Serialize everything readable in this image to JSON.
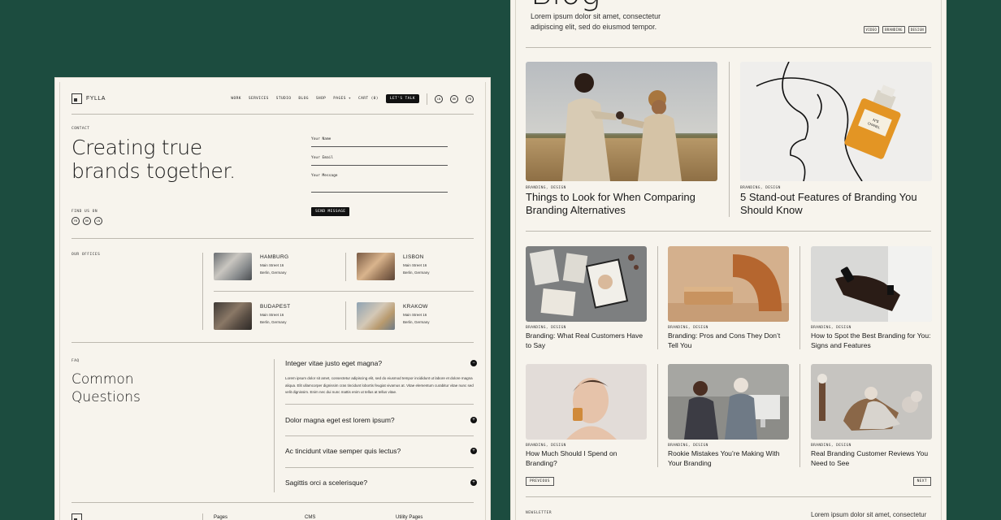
{
  "left_page": {
    "logo": "FYLLA",
    "nav": [
      "WORK",
      "SERVICES",
      "STUDIO",
      "BLOG",
      "SHOP",
      "PAGES +",
      "CART (0)"
    ],
    "talk_button": "LET'S TALK",
    "social": [
      "LN",
      "DR",
      "FB"
    ],
    "contact_label": "CONTACT",
    "hero_line1": "Creating true",
    "hero_line2": "brands together.",
    "find_label": "FIND US ON",
    "find_social": [
      "FB",
      "DR",
      "LN"
    ],
    "form": {
      "name_placeholder": "Your Name",
      "email_placeholder": "Your Email",
      "message_placeholder": "Your Message",
      "send": "SEND MESSAGE"
    },
    "offices_label": "OUR OFFICES",
    "offices": [
      {
        "name": "HAMBURG",
        "street": "Main Street 16",
        "city": "Berlin, Germany"
      },
      {
        "name": "LISBON",
        "street": "Main Street 16",
        "city": "Berlin, Germany"
      },
      {
        "name": "BUDAPEST",
        "street": "Main Street 16",
        "city": "Berlin, Germany"
      },
      {
        "name": "KRAKOW",
        "street": "Main Street 16",
        "city": "Berlin, Germany"
      }
    ],
    "faq_label": "FAQ",
    "faq_title1": "Common",
    "faq_title2": "Questions",
    "faqs": [
      {
        "q": "Integer vitae justo eget magna?",
        "a": "Lorem ipsum dolor sit amet, consectetur adipiscing elit, sed do eiusmod tempor incididunt ut labore et dolore magna aliqua. Elit ullamcorper dignissim cras tincidunt lobortis feugiat vivamus at. Vitae elementum curabitur vitae nunc sed velit dignissim. Enim nec dui nunc mattis enim ut tellus at tellus vitae.",
        "toggle": "−"
      },
      {
        "q": "Dolor magna eget est lorem ipsum?",
        "toggle": "+"
      },
      {
        "q": "Ac tincidunt vitae semper quis lectus?",
        "toggle": "+"
      },
      {
        "q": "Sagittis orci a scelerisque?",
        "toggle": "+"
      }
    ],
    "footer": [
      "Pages",
      "CMS",
      "Utility Pages"
    ]
  },
  "right_page": {
    "title": "Blog",
    "intro": "Lorem ipsum dolor sit amet, consectetur adipiscing elit, sed do eiusmod tempor.",
    "tags": [
      "VIDEO",
      "BRANDING",
      "DESIGN"
    ],
    "posts": [
      {
        "cat": "BRANDING, DESIGN",
        "title": "Things to Look for When Comparing Branding Alternatives"
      },
      {
        "cat": "BRANDING, DESIGN",
        "title": "5 Stand-out Features of Branding You Should Know"
      },
      {
        "cat": "BRANDING, DESIGN",
        "title": "Branding: What Real Customers Have to Say"
      },
      {
        "cat": "BRANDING, DESIGN",
        "title": "Branding: Pros and Cons They Don’t Tell You"
      },
      {
        "cat": "BRANDING, DESIGN",
        "title": "How to Spot the Best Branding for You: Signs and Features"
      },
      {
        "cat": "BRANDING, DESIGN",
        "title": "How Much Should I Spend on Branding?"
      },
      {
        "cat": "BRANDING, DESIGN",
        "title": "Rookie Mistakes You’re Making With Your Branding"
      },
      {
        "cat": "BRANDING, DESIGN",
        "title": "Real Branding Customer Reviews You Need to See"
      }
    ],
    "previous": "PREVIOUS",
    "next": "NEXT",
    "newsletter_label": "NEWSLETTER",
    "newsletter_text": "Lorem ipsum dolor sit amet, consectetur"
  }
}
